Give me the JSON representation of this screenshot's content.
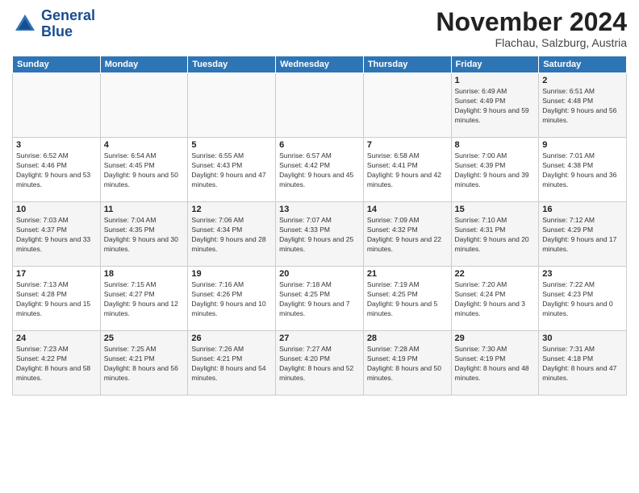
{
  "header": {
    "logo_line1": "General",
    "logo_line2": "Blue",
    "month": "November 2024",
    "location": "Flachau, Salzburg, Austria"
  },
  "weekdays": [
    "Sunday",
    "Monday",
    "Tuesday",
    "Wednesday",
    "Thursday",
    "Friday",
    "Saturday"
  ],
  "weeks": [
    [
      {
        "day": "",
        "info": ""
      },
      {
        "day": "",
        "info": ""
      },
      {
        "day": "",
        "info": ""
      },
      {
        "day": "",
        "info": ""
      },
      {
        "day": "",
        "info": ""
      },
      {
        "day": "1",
        "info": "Sunrise: 6:49 AM\nSunset: 4:49 PM\nDaylight: 9 hours and 59 minutes."
      },
      {
        "day": "2",
        "info": "Sunrise: 6:51 AM\nSunset: 4:48 PM\nDaylight: 9 hours and 56 minutes."
      }
    ],
    [
      {
        "day": "3",
        "info": "Sunrise: 6:52 AM\nSunset: 4:46 PM\nDaylight: 9 hours and 53 minutes."
      },
      {
        "day": "4",
        "info": "Sunrise: 6:54 AM\nSunset: 4:45 PM\nDaylight: 9 hours and 50 minutes."
      },
      {
        "day": "5",
        "info": "Sunrise: 6:55 AM\nSunset: 4:43 PM\nDaylight: 9 hours and 47 minutes."
      },
      {
        "day": "6",
        "info": "Sunrise: 6:57 AM\nSunset: 4:42 PM\nDaylight: 9 hours and 45 minutes."
      },
      {
        "day": "7",
        "info": "Sunrise: 6:58 AM\nSunset: 4:41 PM\nDaylight: 9 hours and 42 minutes."
      },
      {
        "day": "8",
        "info": "Sunrise: 7:00 AM\nSunset: 4:39 PM\nDaylight: 9 hours and 39 minutes."
      },
      {
        "day": "9",
        "info": "Sunrise: 7:01 AM\nSunset: 4:38 PM\nDaylight: 9 hours and 36 minutes."
      }
    ],
    [
      {
        "day": "10",
        "info": "Sunrise: 7:03 AM\nSunset: 4:37 PM\nDaylight: 9 hours and 33 minutes."
      },
      {
        "day": "11",
        "info": "Sunrise: 7:04 AM\nSunset: 4:35 PM\nDaylight: 9 hours and 30 minutes."
      },
      {
        "day": "12",
        "info": "Sunrise: 7:06 AM\nSunset: 4:34 PM\nDaylight: 9 hours and 28 minutes."
      },
      {
        "day": "13",
        "info": "Sunrise: 7:07 AM\nSunset: 4:33 PM\nDaylight: 9 hours and 25 minutes."
      },
      {
        "day": "14",
        "info": "Sunrise: 7:09 AM\nSunset: 4:32 PM\nDaylight: 9 hours and 22 minutes."
      },
      {
        "day": "15",
        "info": "Sunrise: 7:10 AM\nSunset: 4:31 PM\nDaylight: 9 hours and 20 minutes."
      },
      {
        "day": "16",
        "info": "Sunrise: 7:12 AM\nSunset: 4:29 PM\nDaylight: 9 hours and 17 minutes."
      }
    ],
    [
      {
        "day": "17",
        "info": "Sunrise: 7:13 AM\nSunset: 4:28 PM\nDaylight: 9 hours and 15 minutes."
      },
      {
        "day": "18",
        "info": "Sunrise: 7:15 AM\nSunset: 4:27 PM\nDaylight: 9 hours and 12 minutes."
      },
      {
        "day": "19",
        "info": "Sunrise: 7:16 AM\nSunset: 4:26 PM\nDaylight: 9 hours and 10 minutes."
      },
      {
        "day": "20",
        "info": "Sunrise: 7:18 AM\nSunset: 4:25 PM\nDaylight: 9 hours and 7 minutes."
      },
      {
        "day": "21",
        "info": "Sunrise: 7:19 AM\nSunset: 4:25 PM\nDaylight: 9 hours and 5 minutes."
      },
      {
        "day": "22",
        "info": "Sunrise: 7:20 AM\nSunset: 4:24 PM\nDaylight: 9 hours and 3 minutes."
      },
      {
        "day": "23",
        "info": "Sunrise: 7:22 AM\nSunset: 4:23 PM\nDaylight: 9 hours and 0 minutes."
      }
    ],
    [
      {
        "day": "24",
        "info": "Sunrise: 7:23 AM\nSunset: 4:22 PM\nDaylight: 8 hours and 58 minutes."
      },
      {
        "day": "25",
        "info": "Sunrise: 7:25 AM\nSunset: 4:21 PM\nDaylight: 8 hours and 56 minutes."
      },
      {
        "day": "26",
        "info": "Sunrise: 7:26 AM\nSunset: 4:21 PM\nDaylight: 8 hours and 54 minutes."
      },
      {
        "day": "27",
        "info": "Sunrise: 7:27 AM\nSunset: 4:20 PM\nDaylight: 8 hours and 52 minutes."
      },
      {
        "day": "28",
        "info": "Sunrise: 7:28 AM\nSunset: 4:19 PM\nDaylight: 8 hours and 50 minutes."
      },
      {
        "day": "29",
        "info": "Sunrise: 7:30 AM\nSunset: 4:19 PM\nDaylight: 8 hours and 48 minutes."
      },
      {
        "day": "30",
        "info": "Sunrise: 7:31 AM\nSunset: 4:18 PM\nDaylight: 8 hours and 47 minutes."
      }
    ]
  ]
}
